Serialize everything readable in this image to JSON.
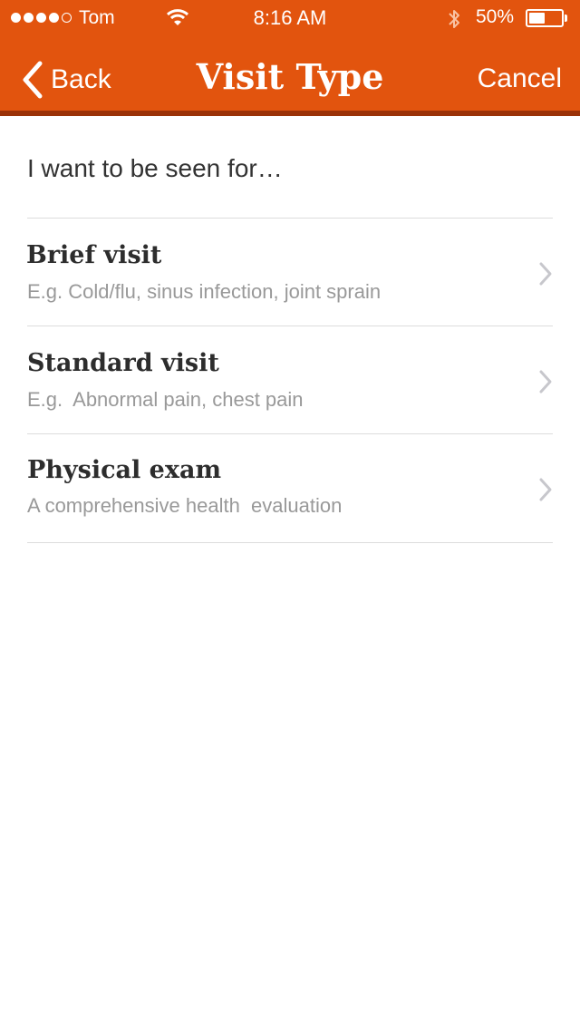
{
  "status_bar": {
    "carrier": "Tom",
    "time": "8:16 AM",
    "battery_percent": "50%",
    "battery_level": 0.5,
    "signal_bars_filled": 4,
    "signal_bars_total": 5
  },
  "nav": {
    "back_label": "Back",
    "title": "Visit Type",
    "cancel_label": "Cancel"
  },
  "prompt": "I want to be seen for…",
  "items": [
    {
      "title": "Brief visit",
      "subtitle": "E.g. Cold/flu, sinus infection, joint sprain"
    },
    {
      "title": "Standard visit",
      "subtitle": "E.g.  Abnormal pain, chest pain"
    },
    {
      "title": "Physical exam",
      "subtitle": "A comprehensive health  evaluation"
    }
  ],
  "colors": {
    "header": "#e2540e",
    "header_shadow": "#9a3207",
    "title_text": "#2d2d2d",
    "subtitle_text": "#999999"
  }
}
